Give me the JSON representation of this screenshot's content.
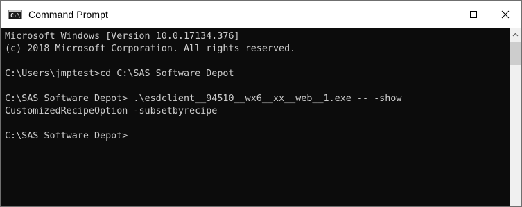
{
  "window": {
    "title": "Command Prompt",
    "icon_label": "C:\\"
  },
  "icons": {
    "app": "cmd-icon",
    "minimize": "minimize-icon",
    "maximize": "maximize-icon",
    "close": "close-icon",
    "scroll_up": "scroll-up-arrow-icon"
  },
  "colors": {
    "terminal_bg": "#0c0c0c",
    "terminal_text": "#cccccc",
    "titlebar_bg": "#ffffff"
  },
  "terminal": {
    "lines": [
      "Microsoft Windows [Version 10.0.17134.376]",
      "(c) 2018 Microsoft Corporation. All rights reserved.",
      "",
      "C:\\Users\\jmptest>cd C:\\SAS Software Depot",
      "",
      "C:\\SAS Software Depot> .\\esdclient__94510__wx6__xx__web__1.exe -- -show",
      "CustomizedRecipeOption -subsetbyrecipe",
      "",
      "C:\\SAS Software Depot>"
    ]
  }
}
